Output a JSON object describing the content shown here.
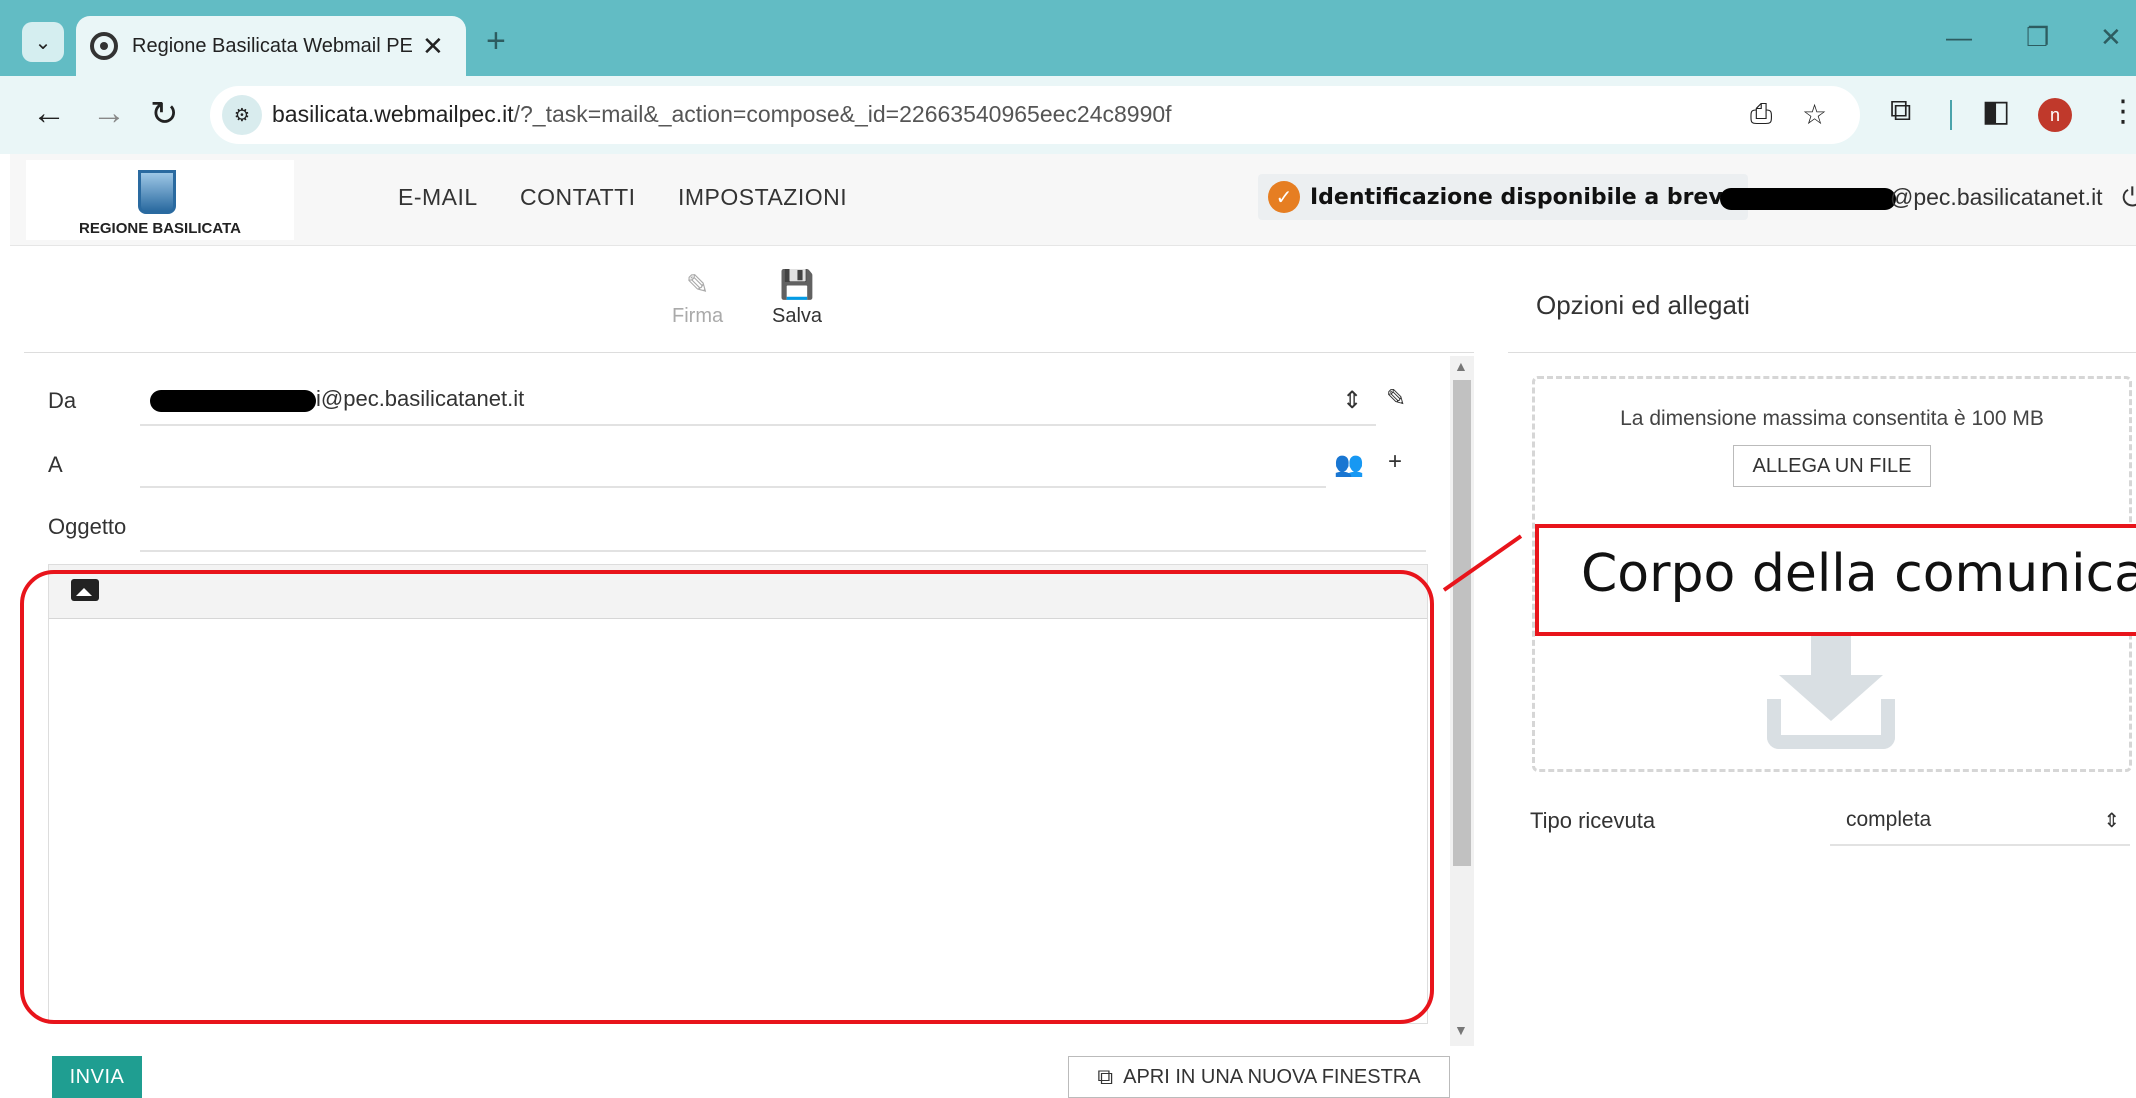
{
  "browser": {
    "tab_title": "Regione Basilicata Webmail PEC",
    "tab_close": "✕",
    "new_tab": "+",
    "url_host": "basilicata.webmailpec.it",
    "url_rest": "/?_task=mail&_action=compose&_id=22663540965eec24c8990f",
    "avatar_initial": "n"
  },
  "header": {
    "logo_text": "REGIONE BASILICATA",
    "menu": [
      "E-MAIL",
      "CONTATTI",
      "IMPOSTAZIONI"
    ],
    "identification": "Identificazione disponibile a breve",
    "user_email_suffix": "@pec.basilicatanet.it"
  },
  "toolbar": {
    "firma_label": "Firma",
    "salva_label": "Salva"
  },
  "compose": {
    "from_label": "Da",
    "from_value_suffix": "i@pec.basilicatanet.it",
    "to_label": "A",
    "subject_label": "Oggetto"
  },
  "actions": {
    "send_label": "INVIA",
    "open_window_label": "APRI IN UNA NUOVA FINESTRA"
  },
  "right_panel": {
    "title": "Opzioni ed allegati",
    "max_size_text": "La dimensione massima consentita è 100 MB",
    "attach_button": "ALLEGA UN FILE",
    "receipt_label": "Tipo ricevuta",
    "receipt_value": "completa"
  },
  "annotation": {
    "text": "Corpo della comunicazione"
  },
  "colors": {
    "tabbar": "#62bcc4",
    "accent_send": "#1f9e91",
    "highlight_red": "#e8141b"
  }
}
